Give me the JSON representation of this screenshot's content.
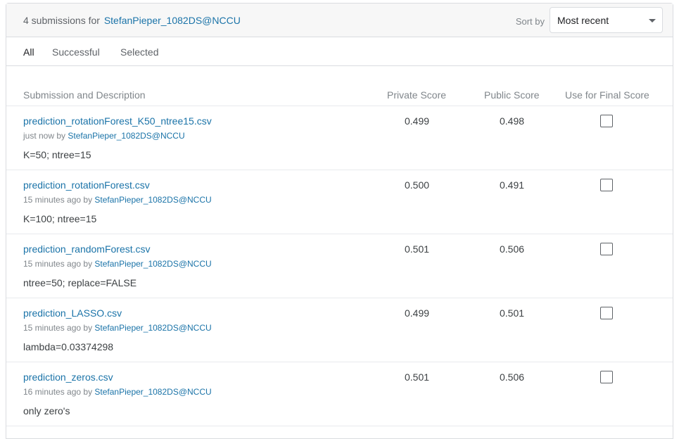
{
  "header": {
    "count_text": "4 submissions for",
    "user": "StefanPieper_1082DS@NCCU",
    "sort_label": "Sort by",
    "sort_value": "Most recent"
  },
  "tabs": [
    {
      "label": "All",
      "active": true
    },
    {
      "label": "Successful",
      "active": false
    },
    {
      "label": "Selected",
      "active": false
    }
  ],
  "columns": {
    "desc": "Submission and Description",
    "private": "Private Score",
    "public": "Public Score",
    "final": "Use for Final Score"
  },
  "rows": [
    {
      "file": "prediction_rotationForest_K50_ntree15.csv",
      "time": "just now by",
      "user": "StefanPieper_1082DS@NCCU",
      "description": "K=50; ntree=15",
      "private": "0.499",
      "public": "0.498",
      "checked": false
    },
    {
      "file": "prediction_rotationForest.csv",
      "time": "15 minutes ago by",
      "user": "StefanPieper_1082DS@NCCU",
      "description": "K=100; ntree=15",
      "private": "0.500",
      "public": "0.491",
      "checked": false
    },
    {
      "file": "prediction_randomForest.csv",
      "time": "15 minutes ago by",
      "user": "StefanPieper_1082DS@NCCU",
      "description": "ntree=50; replace=FALSE",
      "private": "0.501",
      "public": "0.506",
      "checked": false
    },
    {
      "file": "prediction_LASSO.csv",
      "time": "15 minutes ago by",
      "user": "StefanPieper_1082DS@NCCU",
      "description": "lambda=0.03374298",
      "private": "0.499",
      "public": "0.501",
      "checked": false
    },
    {
      "file": "prediction_zeros.csv",
      "time": "16 minutes ago by",
      "user": "StefanPieper_1082DS@NCCU",
      "description": "only zero's",
      "private": "0.501",
      "public": "0.506",
      "checked": false
    }
  ]
}
